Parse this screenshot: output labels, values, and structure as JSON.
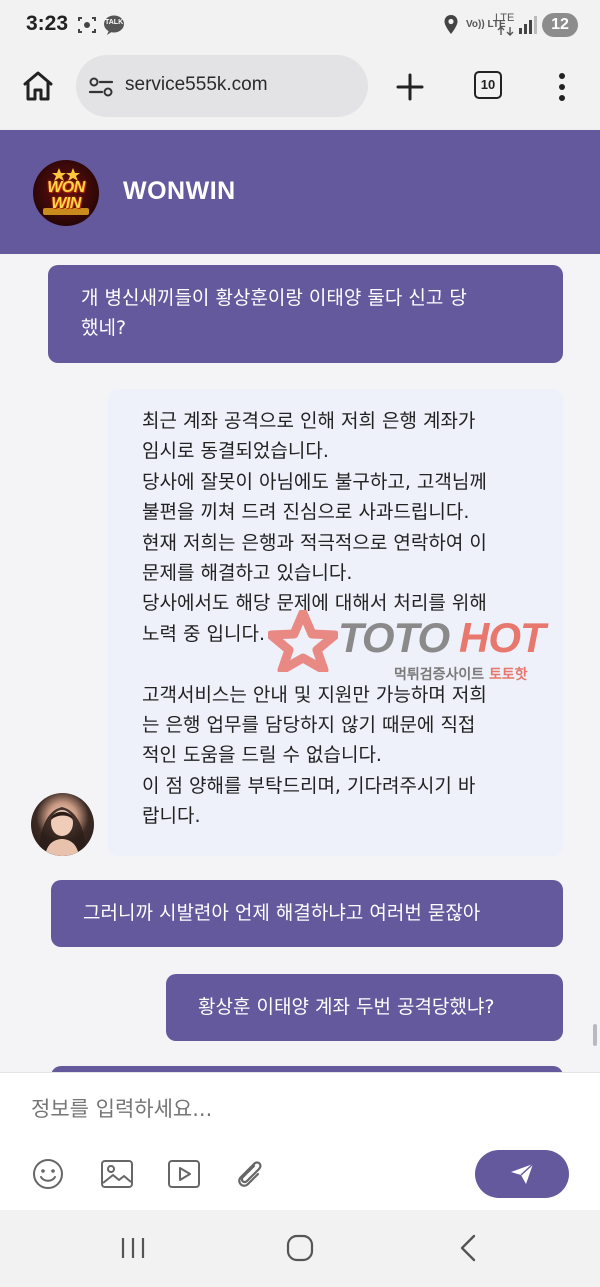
{
  "status_bar": {
    "time": "3:23",
    "talk_label": "TALK",
    "network_volte": "Vo)) LTE",
    "network_type": "LTE",
    "battery": "12"
  },
  "browser": {
    "url": "service555k.com",
    "tab_count": "10"
  },
  "header": {
    "logo_top": "WON",
    "logo_bottom": "WIN",
    "brand_name": "WONWIN"
  },
  "messages": [
    {
      "from": "user",
      "lines": [
        "개 병신새끼들이 황상훈이랑 이태양 둘다 신고 당",
        "했네?"
      ]
    },
    {
      "from": "agent",
      "lines": [
        "최근 계좌 공격으로 인해 저희 은행 계좌가",
        "임시로 동결되었습니다.",
        "당사에 잘못이 아님에도 불구하고, 고객님께",
        "불편을 끼쳐 드려 진심으로 사과드립니다.",
        "현재 저희는 은행과 적극적으로 연락하여 이",
        "문제를 해결하고 있습니다.",
        "당사에서도 해당 문제에 대해서 처리를 위해",
        "노력 중 입니다.",
        "",
        "고객서비스는 안내 및 지원만 가능하며 저희",
        "는 은행 업무를 담당하지 않기 때문에 직접",
        "적인 도움을 드릴 수 없습니다.",
        "이 점 양해를 부탁드리며, 기다려주시기 바",
        "랍니다."
      ]
    },
    {
      "from": "user",
      "lines": [
        "그러니까 시발련아 언제 해결하냐고 여러번 묻잖아"
      ]
    },
    {
      "from": "user",
      "lines": [
        "황상훈 이태양 계좌 두번 공격당했냐?"
      ]
    }
  ],
  "watermark": {
    "brand_part1": "TOTO",
    "brand_part2": "HOT",
    "sub_part1": "먹튀검증사이트",
    "sub_part2": "토토핫"
  },
  "input": {
    "placeholder": "정보를 입력하세요..."
  },
  "colors": {
    "accent": "#65599d",
    "agent_bubble": "#eef1fa",
    "watermark_red": "#e8776e"
  },
  "icons": {
    "browser": [
      "home-icon",
      "site-settings-icon",
      "plus-icon",
      "tabs-icon",
      "more-icon"
    ],
    "toolbar": [
      "emoji-icon",
      "image-icon",
      "video-icon",
      "attach-icon",
      "send-icon"
    ],
    "nav": [
      "recents-icon",
      "home-nav-icon",
      "back-icon"
    ]
  }
}
